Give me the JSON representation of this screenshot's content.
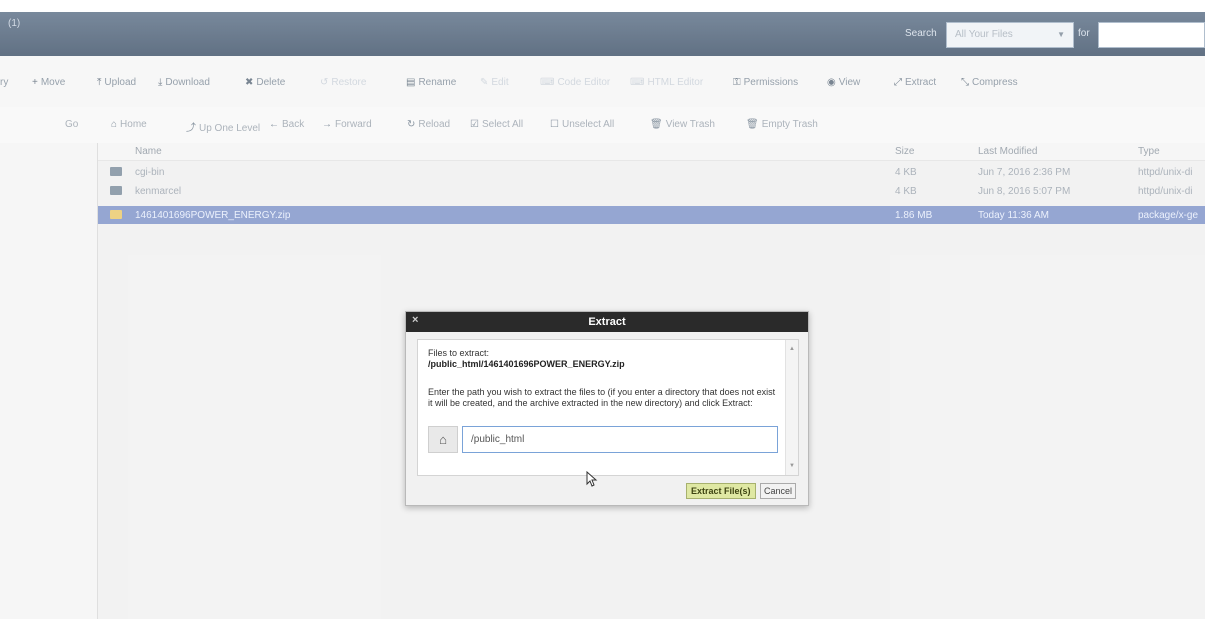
{
  "header": {
    "title": "(1)",
    "search_label": "Search",
    "search_scope": "All Your Files",
    "for_label": "for",
    "search_value": ""
  },
  "toolbar": {
    "items": [
      {
        "label": "ry",
        "icon": ""
      },
      {
        "label": "Move",
        "icon": "+"
      },
      {
        "label": "Upload",
        "icon": "⤒"
      },
      {
        "label": "Download",
        "icon": "⤓"
      },
      {
        "label": "Delete",
        "icon": "✖"
      },
      {
        "label": "Restore",
        "icon": "↺"
      },
      {
        "label": "Rename",
        "icon": "▤"
      },
      {
        "label": "Edit",
        "icon": "✎"
      },
      {
        "label": "Code Editor",
        "icon": "⌨"
      },
      {
        "label": "HTML Editor",
        "icon": "⌨"
      },
      {
        "label": "Permissions",
        "icon": "⚿"
      },
      {
        "label": "View",
        "icon": "◉"
      },
      {
        "label": "Extract",
        "icon": "⤢"
      },
      {
        "label": "Compress",
        "icon": "⤡"
      }
    ]
  },
  "nav": {
    "go": "Go",
    "items": [
      {
        "label": "Home",
        "icon": "⌂"
      },
      {
        "label": "Up One Level",
        "icon": "⤴"
      },
      {
        "label": "Back",
        "icon": "←"
      },
      {
        "label": "Forward",
        "icon": "→"
      },
      {
        "label": "Reload",
        "icon": "↻"
      },
      {
        "label": "Select All",
        "icon": "☑"
      },
      {
        "label": "Unselect All",
        "icon": "☐"
      },
      {
        "label": "View Trash",
        "icon": "🗑"
      },
      {
        "label": "Empty Trash",
        "icon": "🗑"
      }
    ]
  },
  "table": {
    "columns": {
      "name": "Name",
      "size": "Size",
      "modified": "Last Modified",
      "type": "Type"
    },
    "rows": [
      {
        "name": "cgi-bin",
        "size": "4 KB",
        "modified": "Jun 7, 2016 2:36 PM",
        "type": "httpd/unix-di"
      },
      {
        "name": "kenmarcel",
        "size": "4 KB",
        "modified": "Jun 8, 2016 5:07 PM",
        "type": "httpd/unix-di"
      },
      {
        "name": "1461401696POWER_ENERGY.zip",
        "size": "1.86 MB",
        "modified": "Today 11:36 AM",
        "type": "package/x-ge"
      }
    ]
  },
  "dialog": {
    "close": "×",
    "title": "Extract",
    "files_label": "Files to extract:",
    "files_path": "/public_html/1461401696POWER_ENERGY.zip",
    "instructions": "Enter the path you wish to extract the files to (if you enter a directory that does not exist it will be created, and the archive extracted in the new directory) and click Extract:",
    "path_value": "/public_html",
    "extract_button": "Extract File(s)",
    "cancel_button": "Cancel"
  }
}
